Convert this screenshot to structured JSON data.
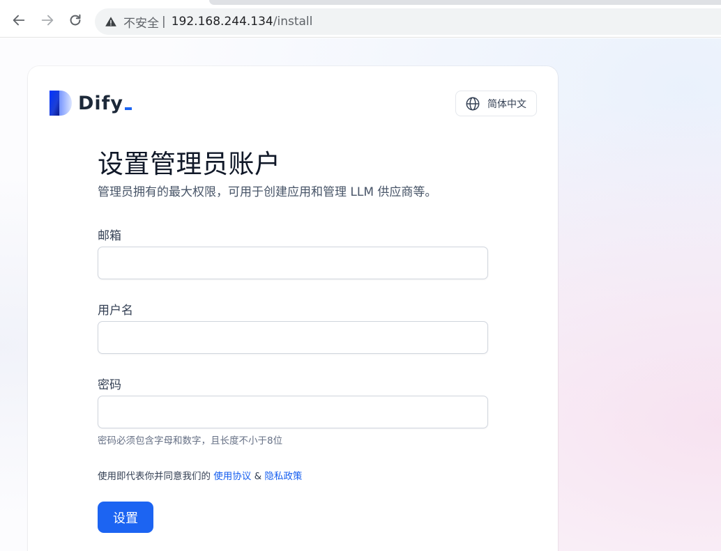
{
  "browser": {
    "security_label": "不安全",
    "separator": "|",
    "url_host": "192.168.244.134",
    "url_path": "/install"
  },
  "app": {
    "logo_text": "Dify",
    "language_label": "简体中文",
    "brand_color": "#1c64f2"
  },
  "form": {
    "title": "设置管理员账户",
    "subtitle": "管理员拥有的最大权限，可用于创建应用和管理 LLM 供应商等。",
    "email_label": "邮箱",
    "email_value": "",
    "username_label": "用户名",
    "username_value": "",
    "password_label": "密码",
    "password_value": "",
    "password_hint": "密码必须包含字母和数字，且长度不小于8位",
    "agree_prefix": "使用即代表你并同意我们的",
    "terms_link": "使用协议",
    "and_text": "&",
    "privacy_link": "隐私政策",
    "submit_label": "设置"
  }
}
